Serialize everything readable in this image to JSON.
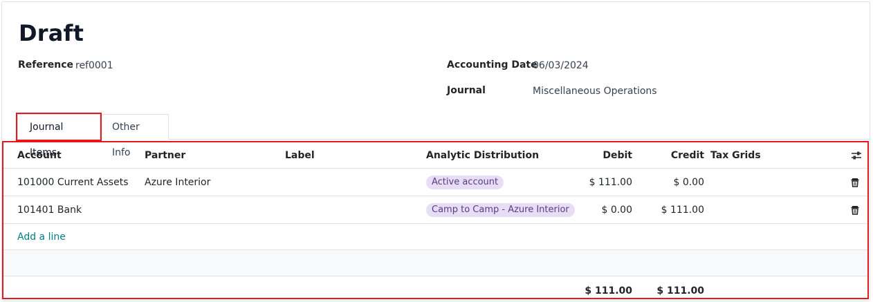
{
  "record": {
    "title": "Draft",
    "reference_label": "Reference",
    "reference_value": "ref0001",
    "accounting_date_label": "Accounting Date",
    "accounting_date_value": "06/03/2024",
    "journal_label": "Journal",
    "journal_value": "Miscellaneous Operations"
  },
  "tabs": [
    {
      "label": "Journal Items",
      "active": true
    },
    {
      "label": "Other Info",
      "active": false
    }
  ],
  "table": {
    "headers": {
      "account": "Account",
      "partner": "Partner",
      "label": "Label",
      "analytic": "Analytic Distribution",
      "debit": "Debit",
      "credit": "Credit",
      "tax_grids": "Tax Grids"
    },
    "rows": [
      {
        "account": "101000 Current Assets",
        "partner": "Azure Interior",
        "label": "",
        "analytic": "Active account",
        "debit": "$ 111.00",
        "credit": "$ 0.00",
        "tax_grids": ""
      },
      {
        "account": "101401 Bank",
        "partner": "",
        "label": "",
        "analytic": "Camp to Camp - Azure Interior",
        "debit": "$ 0.00",
        "credit": "$ 111.00",
        "tax_grids": ""
      }
    ],
    "add_line_label": "Add a line",
    "totals": {
      "debit": "$ 111.00",
      "credit": "$ 111.00"
    }
  },
  "icons": {
    "settings": "optional-columns-icon",
    "delete": "trash-icon"
  },
  "colors": {
    "highlight": "#e5191d",
    "link": "#017e84",
    "tag_bg": "#e7ddf5",
    "tag_text": "#5b3a86"
  }
}
